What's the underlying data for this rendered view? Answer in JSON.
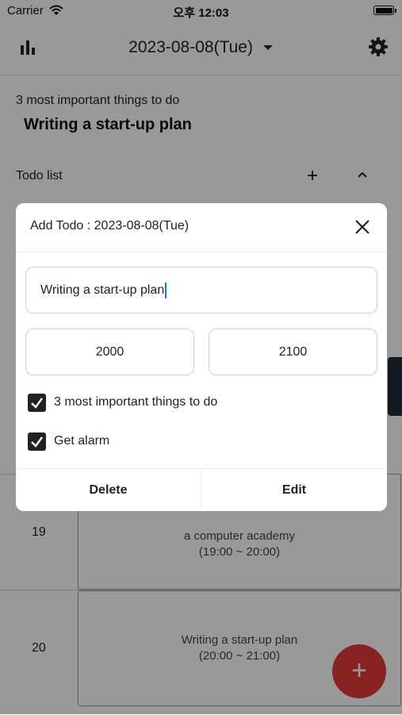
{
  "status_bar": {
    "carrier": "Carrier",
    "time": "오후 12:03"
  },
  "header": {
    "date": "2023-08-08(Tue)"
  },
  "focus": {
    "label": "3 most important things to do",
    "value": "Writing a start-up plan"
  },
  "todo": {
    "label": "Todo list",
    "add_symbol": "+"
  },
  "timeline": [
    {
      "hour": "19",
      "event_title": "a computer academy",
      "event_time": "(19:00 ~ 20:00)"
    },
    {
      "hour": "20",
      "event_title": "Writing a start-up plan",
      "event_time": "(20:00 ~ 21:00)"
    }
  ],
  "fab": {
    "symbol": "+"
  },
  "dialog": {
    "title": "Add Todo : 2023-08-08(Tue)",
    "todo_title_value": "Writing a start-up plan",
    "start_time": "2000",
    "end_time": "2100",
    "important": {
      "label": "3 most important things to do",
      "checked": true
    },
    "alarm": {
      "label": "Get alarm",
      "checked": true
    },
    "delete_label": "Delete",
    "edit_label": "Edit"
  },
  "colors": {
    "fab": "#e23b3b",
    "caret": "#1a73e8",
    "side_tab": "#1f2d3a",
    "overlay": "rgba(0,0,0,0.4)"
  }
}
